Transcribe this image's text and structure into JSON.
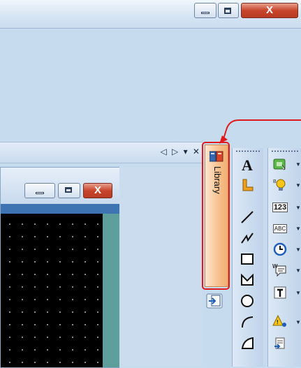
{
  "window": {
    "minimize_label": "minimize",
    "maximize_label": "maximize",
    "close_label": "close"
  },
  "dock": {
    "controls": "◁ ▷ ▾ ✕"
  },
  "library_tab": {
    "label": "Library",
    "icon": "library-book-icon"
  },
  "drawing_toolbar": {
    "tools": [
      {
        "name": "text-tool",
        "glyph": "A"
      },
      {
        "name": "l-shape-tool",
        "glyph": "L"
      },
      {
        "name": "line-tool"
      },
      {
        "name": "polyline-tool"
      },
      {
        "name": "rectangle-tool"
      },
      {
        "name": "polygon-tool"
      },
      {
        "name": "circle-tool"
      },
      {
        "name": "arc-tool"
      },
      {
        "name": "sector-tool"
      }
    ]
  },
  "parts_toolbar": {
    "tools": [
      {
        "name": "switch-part-icon"
      },
      {
        "name": "lamp-part-icon"
      },
      {
        "name": "numeric-display-icon",
        "glyph": "123"
      },
      {
        "name": "string-display-icon",
        "glyph": "ABC"
      },
      {
        "name": "clock-icon"
      },
      {
        "name": "message-display-icon"
      },
      {
        "name": "text-part-icon"
      },
      {
        "name": "alarm-part-icon"
      },
      {
        "name": "recipe-part-icon"
      }
    ]
  },
  "colors": {
    "highlight": "#e01a1a",
    "library_tab": "#f7c08d",
    "canvas": "#000000",
    "tool_orange": "#f0a020"
  }
}
